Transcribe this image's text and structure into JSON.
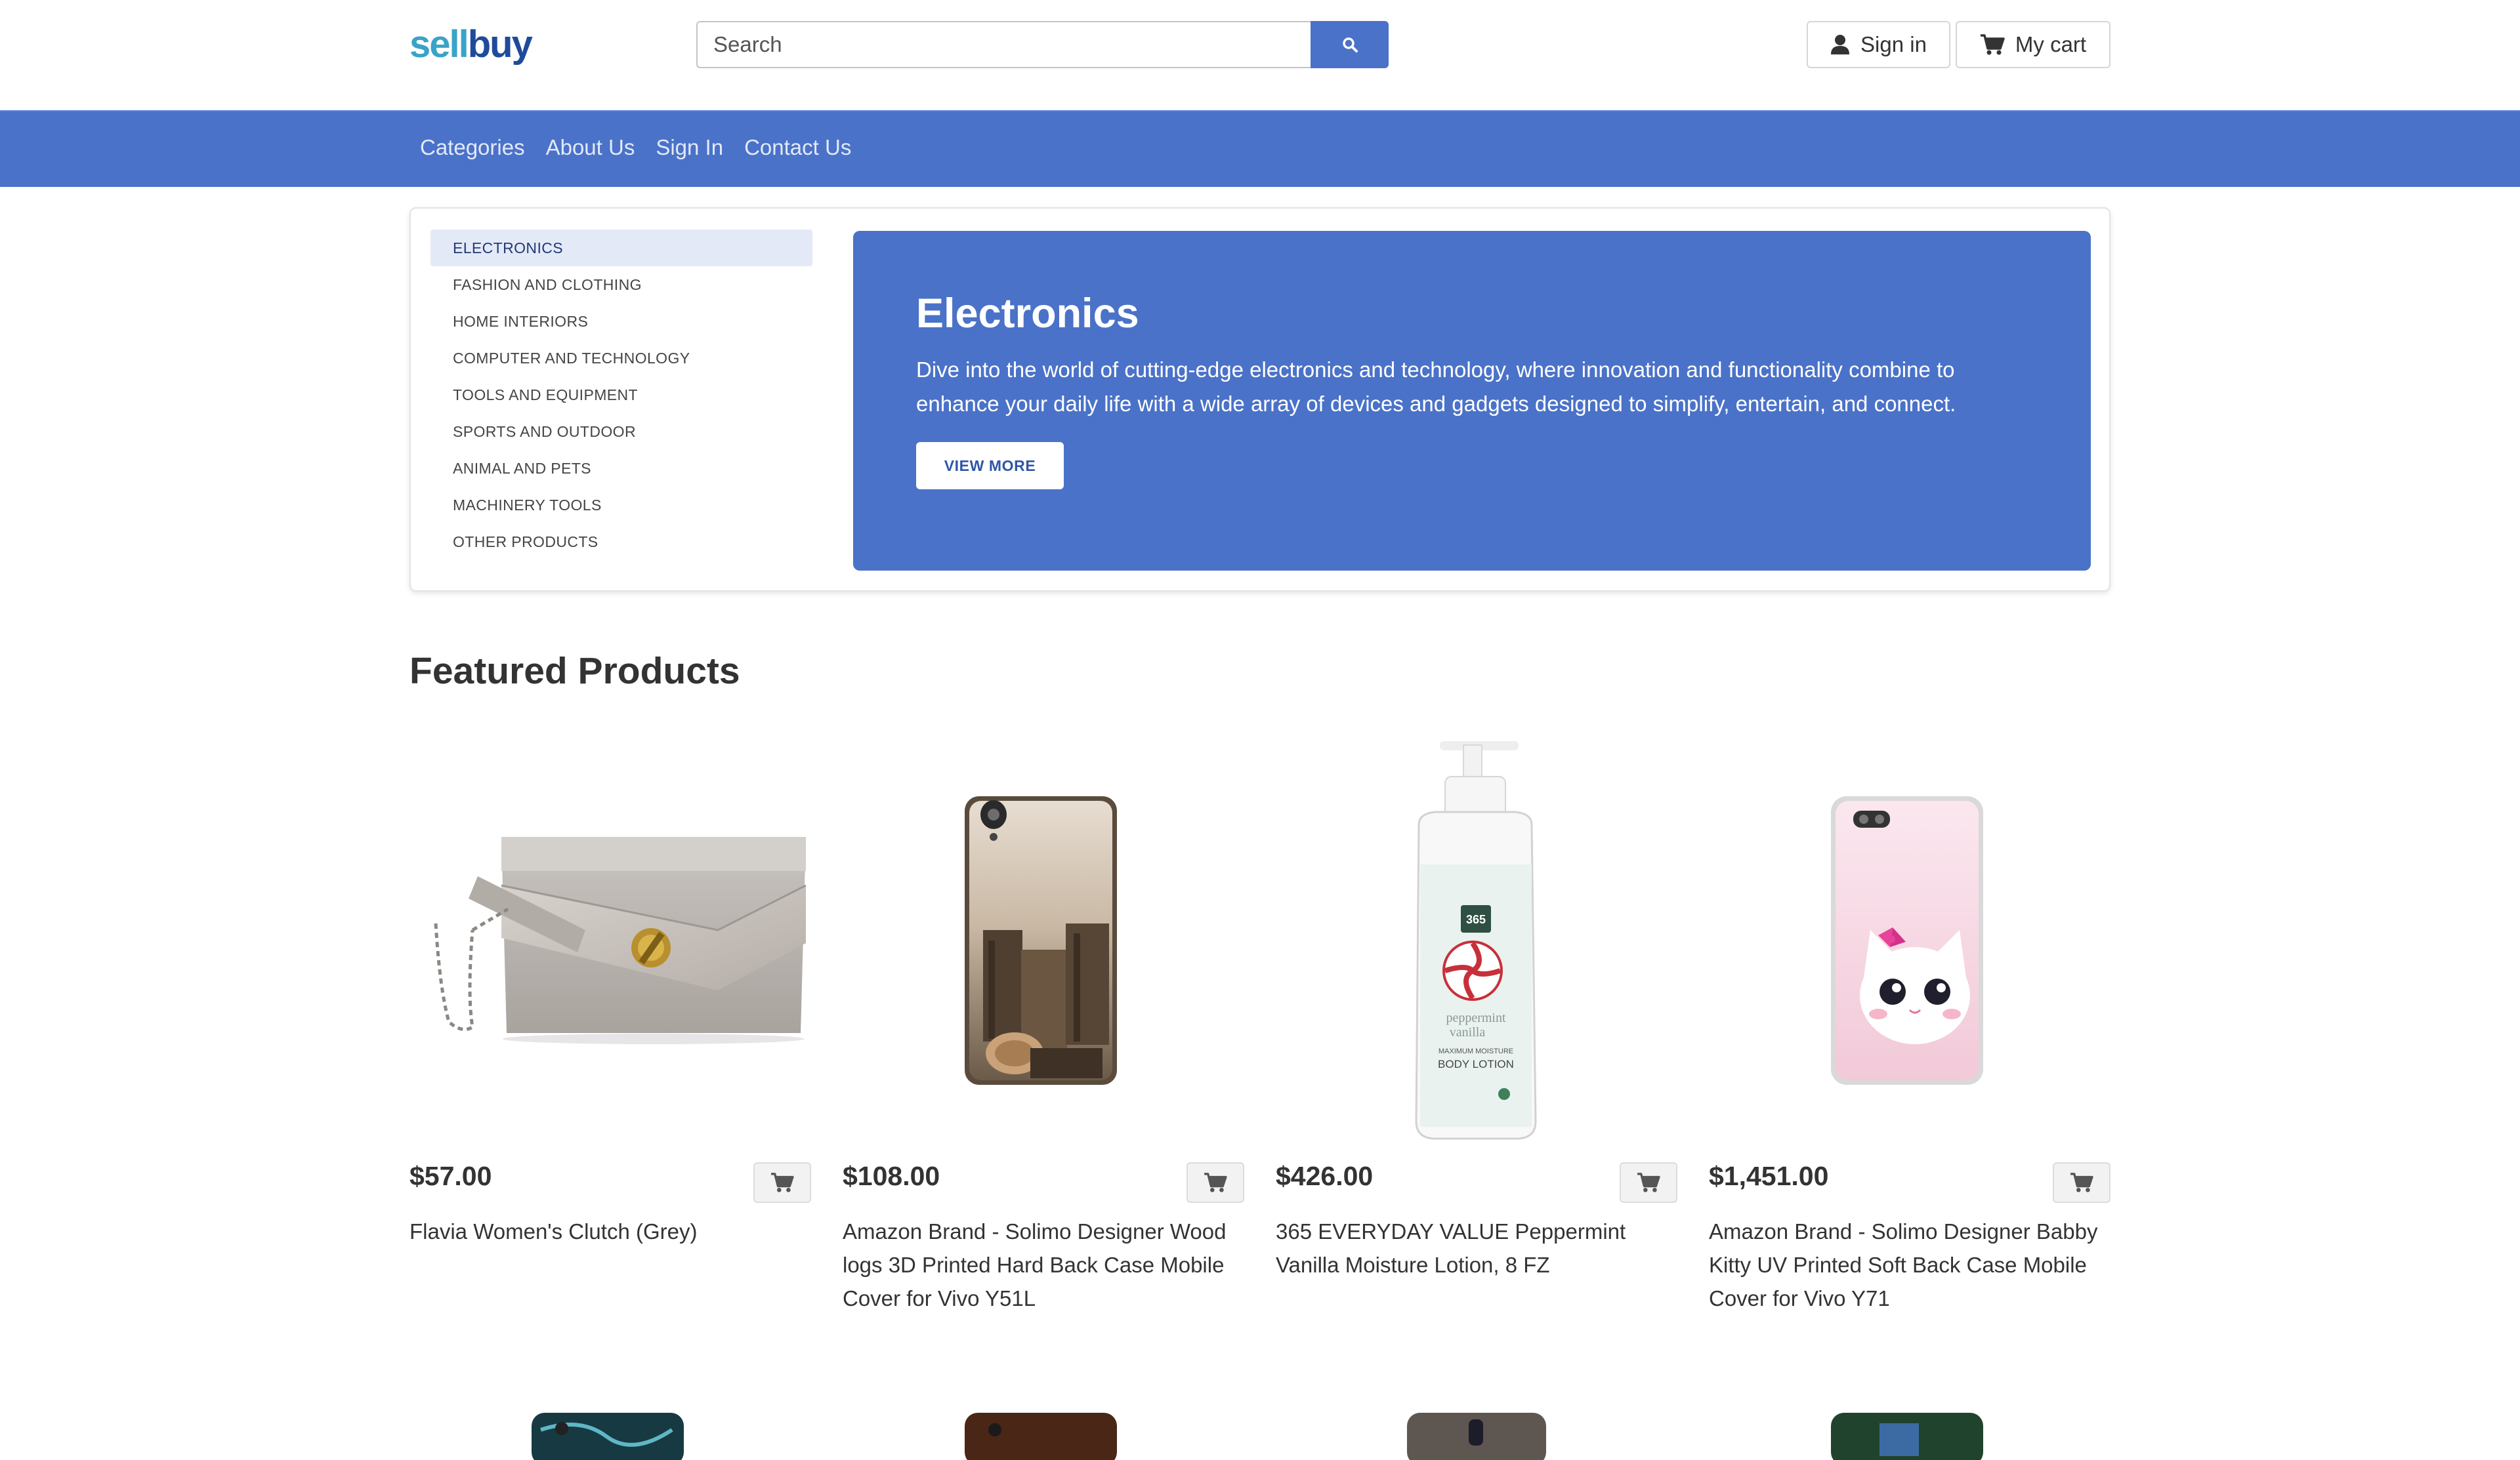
{
  "header": {
    "logo_sell": "sell",
    "logo_buy": "buy",
    "search_placeholder": "Search",
    "search_icon": "search-icon",
    "signin_label": "Sign in",
    "cart_label": "My cart",
    "signin_icon": "user-icon",
    "cart_icon": "cart-icon"
  },
  "nav": {
    "links": [
      "Categories",
      "About Us",
      "Sign In",
      "Contact Us"
    ]
  },
  "categories": {
    "items": [
      "ELECTRONICS",
      "FASHION AND CLOTHING",
      "HOME INTERIORS",
      "COMPUTER AND TECHNOLOGY",
      "TOOLS AND EQUIPMENT",
      "SPORTS AND OUTDOOR",
      "ANIMAL AND PETS",
      "MACHINERY TOOLS",
      "OTHER PRODUCTS"
    ],
    "selected": "ELECTRONICS"
  },
  "hero": {
    "title": "Electronics",
    "text": "Dive into the world of cutting-edge electronics and technology, where innovation and functionality combine to enhance your daily life with a wide array of devices and gadgets designed to simplify, entertain, and connect.",
    "button_label": "VIEW MORE"
  },
  "featured": {
    "title": "Featured Products",
    "products": [
      {
        "price": "$57.00",
        "name": "Flavia Women's Clutch (Grey)",
        "image": "grey-clutch-bag"
      },
      {
        "price": "$108.00",
        "name": "Amazon Brand - Solimo Designer Wood logs 3D Printed Hard Back Case Mobile Cover for Vivo Y51L",
        "image": "wood-logs-phone-case"
      },
      {
        "price": "$426.00",
        "name": "365 EVERYDAY VALUE Peppermint Vanilla Moisture Lotion, 8 FZ",
        "image": "lotion-bottle"
      },
      {
        "price": "$1,451.00",
        "name": "Amazon Brand - Solimo Designer Babby Kitty UV Printed Soft Back Case Mobile Cover for Vivo Y71",
        "image": "kitty-phone-case"
      }
    ],
    "cart_icon": "cart-icon"
  },
  "colors": {
    "primary": "#4a72c8",
    "nav_text": "#e2e9f8",
    "logo_sell": "#3aa3c7",
    "logo_buy": "#1e4b9b",
    "active_category_bg": "#e4e9f7"
  }
}
